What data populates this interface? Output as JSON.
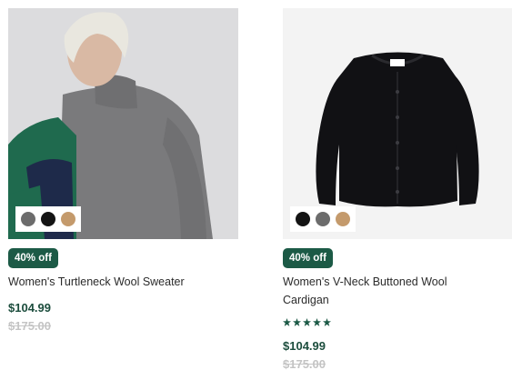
{
  "products": [
    {
      "badge": "40% off",
      "name": "Women's Turtleneck Wool Sweater",
      "price": "$104.99",
      "original_price": "$175.00",
      "swatch_colors": [
        "#6c6c6c",
        "#141414",
        "#c49a6c"
      ]
    },
    {
      "badge": "40% off",
      "name_line1": "Women's V-Neck Buttoned Wool",
      "name_line2": "Cardigan",
      "rating_stars": 5,
      "price": "$104.99",
      "original_price": "$175.00",
      "swatch_colors": [
        "#141414",
        "#6c6c6c",
        "#c49a6c"
      ]
    }
  ],
  "icons": [
    "star-icon"
  ]
}
